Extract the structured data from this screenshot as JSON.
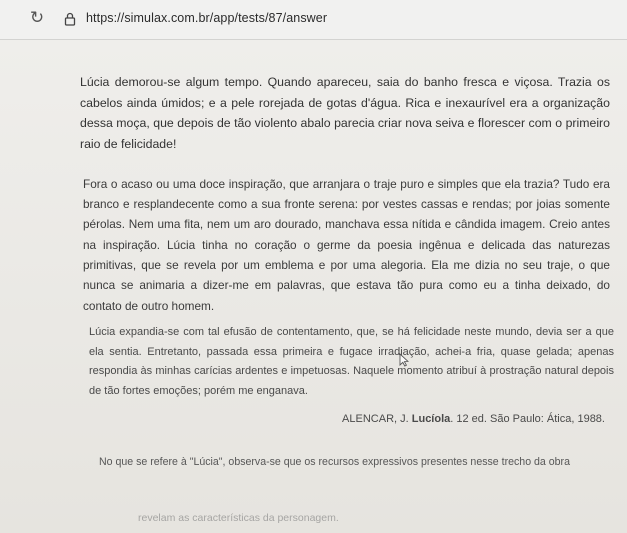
{
  "browser": {
    "url": "https://simulax.com.br/app/tests/87/answer",
    "reload_icon": "reload-icon",
    "lock_icon": "lock-icon"
  },
  "passage": {
    "paragraph_1": "Lúcia demorou-se algum tempo. Quando apareceu, saia do banho fresca e viçosa. Trazia os cabelos ainda úmidos; e a pele rorejada de gotas d'água. Rica e inexaurível era a organização dessa moça, que depois de tão violento abalo parecia criar nova seiva e florescer com o primeiro raio de felicidade!",
    "paragraph_2": "Fora o acaso ou uma doce inspiração, que arranjara o traje puro e simples que ela trazia? Tudo era branco e resplandecente como a sua fronte serena: por vestes cassas e rendas; por joias somente pérolas. Nem uma fita, nem um aro dourado, manchava essa nítida e cândida imagem. Creio antes na inspiração. Lúcia tinha no coração o germe da poesia ingênua e delicada das naturezas primitivas, que se revela por um emblema e por uma alegoria. Ela me dizia no seu traje, o que nunca se animaria a dizer-me em palavras, que estava tão pura como eu a tinha deixado, do contato de outro homem.",
    "paragraph_3": "Lúcia expandia-se com tal efusão de contentamento, que, se há felicidade neste mundo, devia ser a que ela sentia. Entretanto, passada essa primeira e fugace irradiação, achei-a fria, quase gelada; apenas respondia às minhas carícias ardentes e impetuosas. Naquele momento atribuí à prostração natural depois de tão fortes emoções; porém me enganava."
  },
  "citation": {
    "author": "ALENCAR, J.",
    "title": "Lucíola",
    "rest": ". 12 ed. São Paulo: Ática, 1988."
  },
  "question": {
    "text": "No que se refere à \"Lúcia\", observa-se que os recursos expressivos presentes nesse trecho da obra"
  },
  "options": [
    {
      "text": "revelam as características da personagem."
    }
  ]
}
